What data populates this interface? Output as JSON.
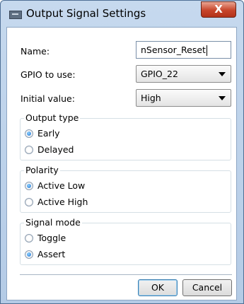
{
  "window": {
    "title": "Output Signal Settings",
    "close_label": "X"
  },
  "fields": {
    "name": {
      "label": "Name:",
      "value": "nSensor_Reset"
    },
    "gpio": {
      "label": "GPIO to use:",
      "value": "GPIO_22"
    },
    "initial": {
      "label": "Initial value:",
      "value": "High"
    }
  },
  "groups": {
    "output_type": {
      "title": "Output type",
      "options": [
        "Early",
        "Delayed"
      ],
      "selected": "Early"
    },
    "polarity": {
      "title": "Polarity",
      "options": [
        "Active Low",
        "Active High"
      ],
      "selected": "Active Low"
    },
    "signal_mode": {
      "title": "Signal mode",
      "options": [
        "Toggle",
        "Assert"
      ],
      "selected": "Assert"
    }
  },
  "buttons": {
    "ok": "OK",
    "cancel": "Cancel"
  }
}
